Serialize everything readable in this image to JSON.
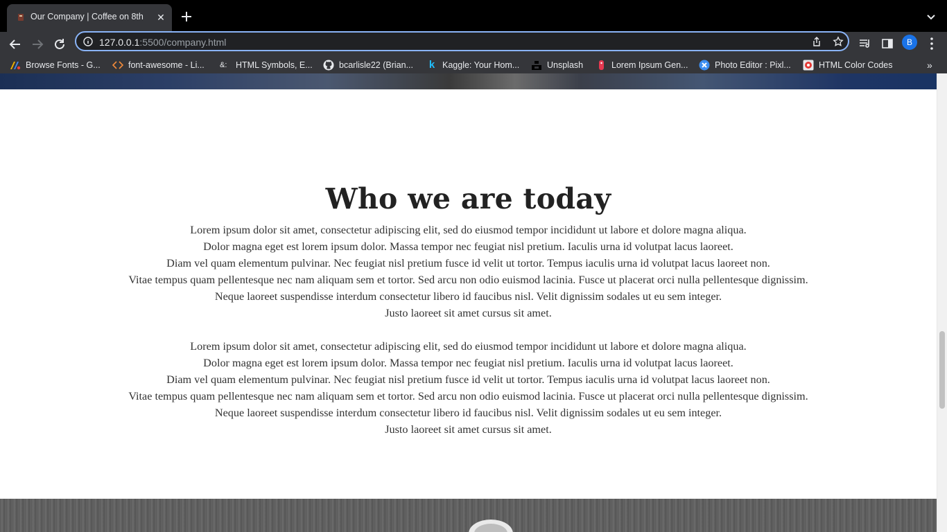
{
  "browser": {
    "tab": {
      "title": "Our Company | Coffee on 8th"
    },
    "omnibox": {
      "host": "127.0.0.1",
      "rest": ":5500/company.html"
    },
    "profile_initial": "B",
    "bookmarks": [
      {
        "label": "Browse Fonts - G...",
        "icon": "google-fonts-icon"
      },
      {
        "label": "font-awesome - Li...",
        "icon": "code-icon"
      },
      {
        "label": "HTML Symbols, E...",
        "icon": "ampersand-icon"
      },
      {
        "label": "bcarlisle22 (Brian...",
        "icon": "github-icon"
      },
      {
        "label": "Kaggle: Your Hom...",
        "icon": "kaggle-icon"
      },
      {
        "label": "Unsplash",
        "icon": "unsplash-icon"
      },
      {
        "label": "Lorem Ipsum Gen...",
        "icon": "lorem-ipsum-icon"
      },
      {
        "label": "Photo Editor : Pixl...",
        "icon": "pixlr-icon"
      },
      {
        "label": "HTML Color Codes",
        "icon": "color-codes-icon"
      }
    ],
    "bookmarks_overflow": "»"
  },
  "page": {
    "heading": "Who we are today",
    "paragraph1": [
      "Lorem ipsum dolor sit amet, consectetur adipiscing elit, sed do eiusmod tempor incididunt ut labore et dolore magna aliqua.",
      "Dolor magna eget est lorem ipsum dolor. Massa tempor nec feugiat nisl pretium. Iaculis urna id volutpat lacus laoreet.",
      "Diam vel quam elementum pulvinar. Nec feugiat nisl pretium fusce id velit ut tortor. Tempus iaculis urna id volutpat lacus laoreet non.",
      "Vitae tempus quam pellentesque nec nam aliquam sem et tortor. Sed arcu non odio euismod lacinia. Fusce ut placerat orci nulla pellentesque dignissim.",
      "Neque laoreet suspendisse interdum consectetur libero id faucibus nisl. Velit dignissim sodales ut eu sem integer.",
      "Justo laoreet sit amet cursus sit amet."
    ],
    "paragraph2": [
      "Lorem ipsum dolor sit amet, consectetur adipiscing elit, sed do eiusmod tempor incididunt ut labore et dolore magna aliqua.",
      "Dolor magna eget est lorem ipsum dolor. Massa tempor nec feugiat nisl pretium. Iaculis urna id volutpat lacus laoreet.",
      "Diam vel quam elementum pulvinar. Nec feugiat nisl pretium fusce id velit ut tortor. Tempus iaculis urna id volutpat lacus laoreet non.",
      "Vitae tempus quam pellentesque nec nam aliquam sem et tortor. Sed arcu non odio euismod lacinia. Fusce ut placerat orci nulla pellentesque dignissim.",
      "Neque laoreet suspendisse interdum consectetur libero id faucibus nisl. Velit dignissim sodales ut eu sem integer.",
      "Justo laoreet sit amet cursus sit amet."
    ]
  },
  "colors": {
    "chrome_dark": "#35363a",
    "tabbar": "#000000",
    "omnibox_focus": "#8ab4f8",
    "profile_avatar": "#1a73e8"
  }
}
